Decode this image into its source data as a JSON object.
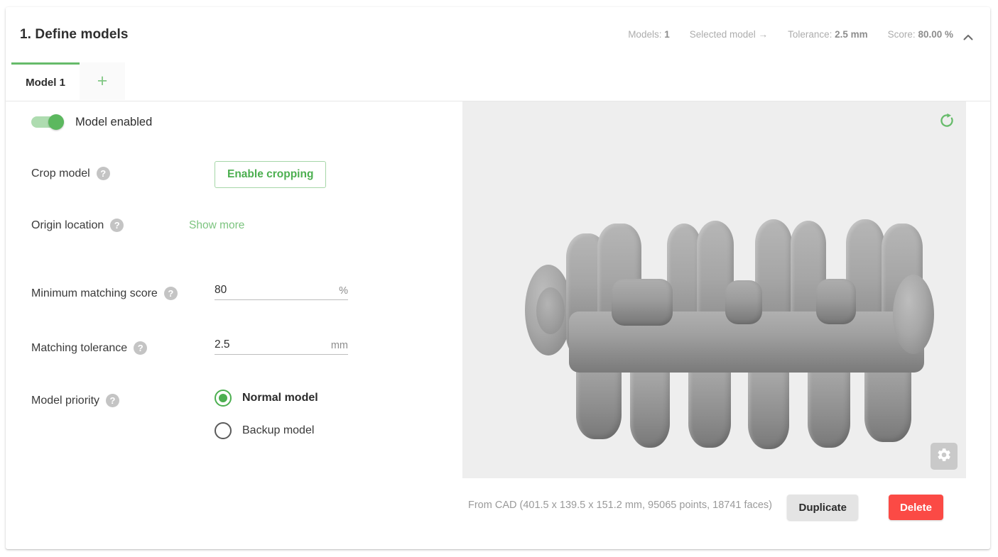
{
  "header": {
    "title": "1. Define models",
    "meta": {
      "models_label": "Models:",
      "models_value": "1",
      "selected_model_link": "Selected model →",
      "tolerance_label": "Tolerance:",
      "tolerance_value": "2.5 mm",
      "score_label": "Score:",
      "score_value": "80.00 %"
    },
    "collapse_icon": "chevron-up-icon"
  },
  "tabs": {
    "items": [
      {
        "label": "Model 1",
        "active": true
      }
    ],
    "add_label": "+"
  },
  "settings": {
    "model_enabled": {
      "label": "Model enabled",
      "on": true
    },
    "crop_model": {
      "label": "Crop model",
      "help": "?",
      "button_label": "Enable cropping"
    },
    "origin_location": {
      "label": "Origin location",
      "help": "?",
      "link_label": "Show more"
    },
    "minimum_matching_score": {
      "label": "Minimum matching score",
      "help": "?",
      "value": "80",
      "unit": "%"
    },
    "matching_tolerance": {
      "label": "Matching tolerance",
      "help": "?",
      "value": "2.5",
      "unit": "mm"
    },
    "model_priority": {
      "label": "Model priority",
      "help": "?",
      "options": [
        {
          "label": "Normal model",
          "selected": true
        },
        {
          "label": "Backup model",
          "selected": false
        }
      ]
    }
  },
  "viewer": {
    "reset_icon": "refresh-icon",
    "settings_icon": "gear-icon",
    "axis_y_color": "#2850d8",
    "axis_x_color": "#e02020",
    "model_description": "crankshaft-cad-model"
  },
  "footer": {
    "cad_info": "From CAD (401.5 x 139.5 x 151.2 mm, 95065 points, 18741 faces)",
    "duplicate_label": "Duplicate",
    "delete_label": "Delete"
  },
  "colors": {
    "accent_green": "#4caf50",
    "danger_red": "#fb4a45",
    "viewer_bg": "#eeeeee"
  }
}
